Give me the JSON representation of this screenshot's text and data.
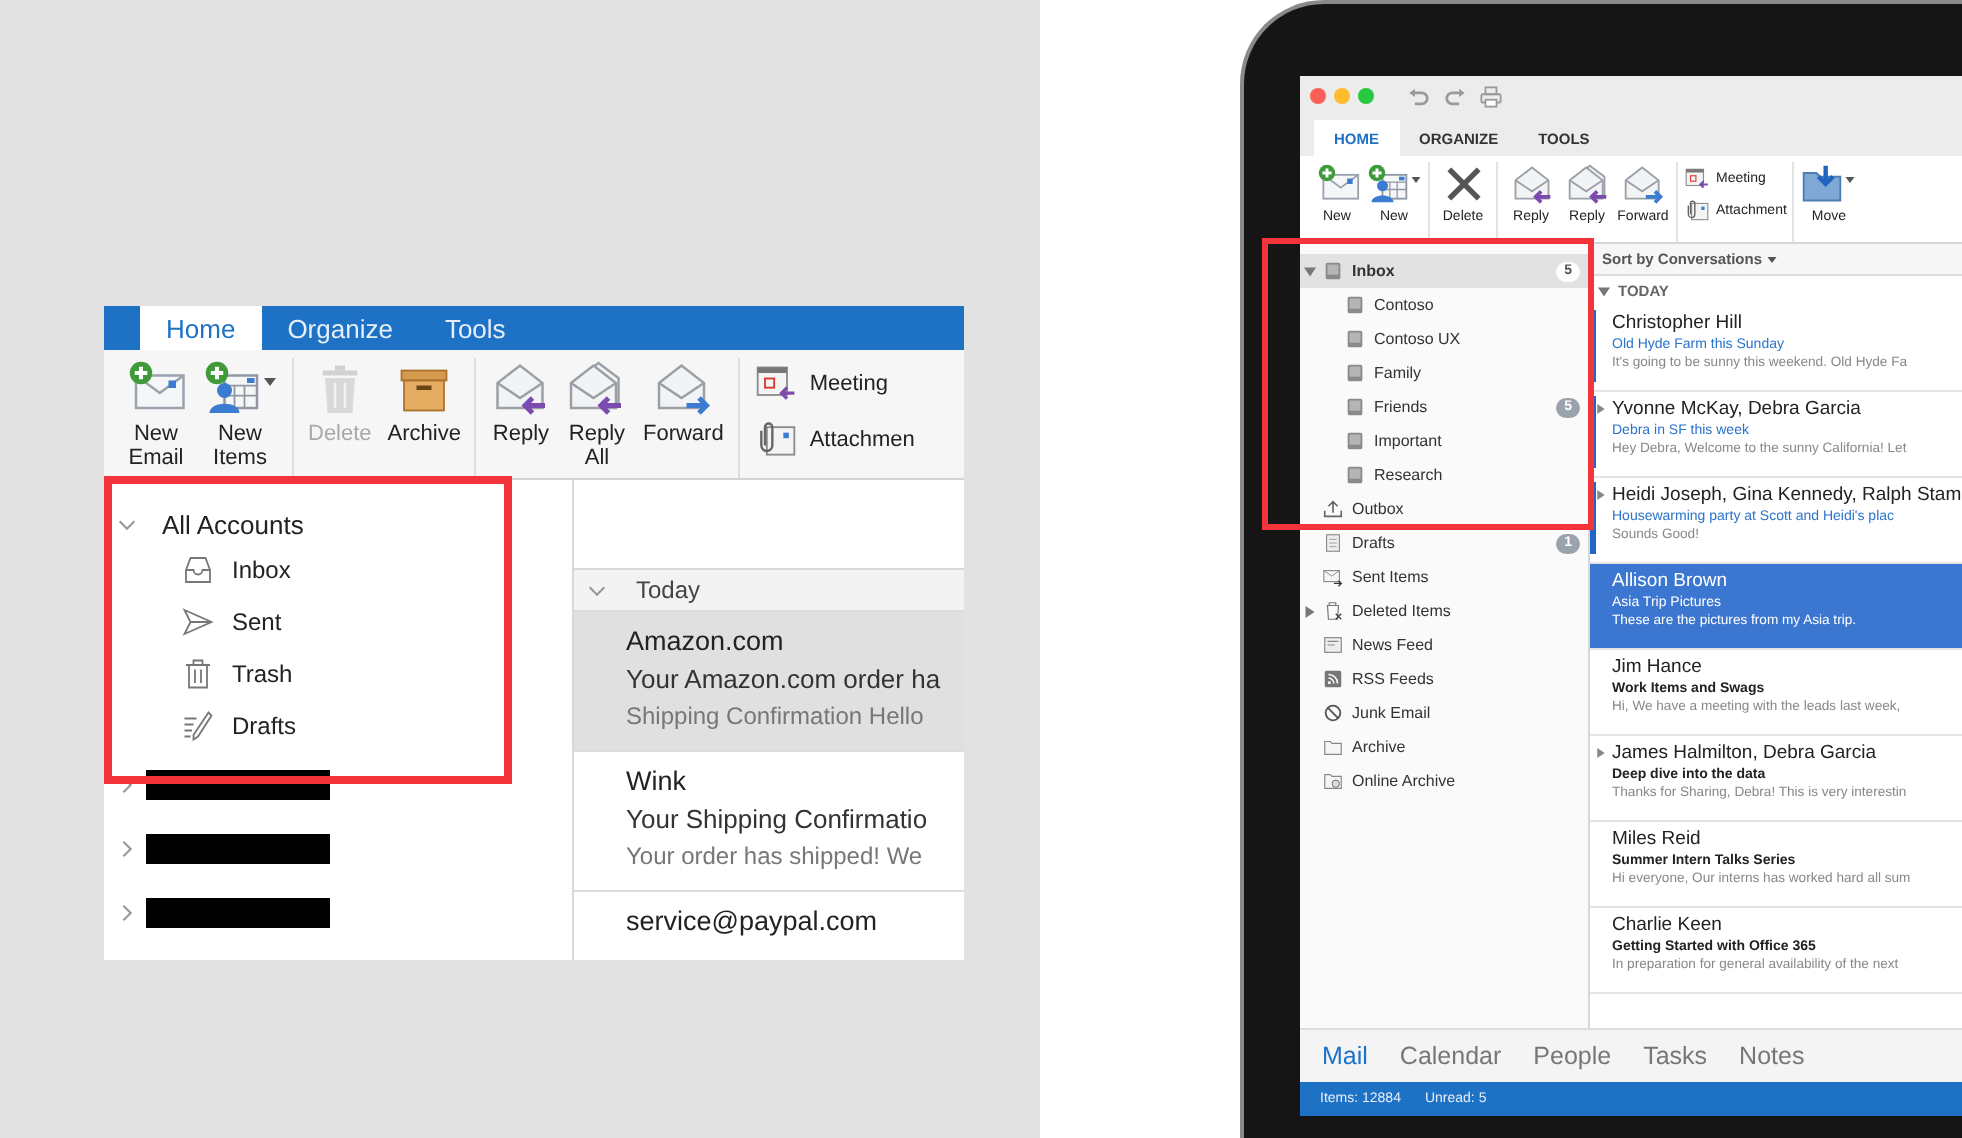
{
  "left_window": {
    "tabs": [
      {
        "label": "Home",
        "selected": true
      },
      {
        "label": "Organize",
        "selected": false
      },
      {
        "label": "Tools",
        "selected": false
      }
    ],
    "ribbon": [
      {
        "buttons": [
          {
            "kind": "new-email",
            "label": "New Email",
            "disabled": false,
            "dropdown": false
          },
          {
            "kind": "new-items",
            "label": "New Items",
            "disabled": false,
            "dropdown": true
          }
        ]
      },
      {
        "buttons": [
          {
            "kind": "delete",
            "label": "Delete",
            "disabled": true,
            "dropdown": false
          },
          {
            "kind": "archive",
            "label": "Archive",
            "disabled": false,
            "dropdown": false
          }
        ]
      },
      {
        "buttons": [
          {
            "kind": "reply",
            "label": "Reply",
            "disabled": false,
            "dropdown": false
          },
          {
            "kind": "reply-all",
            "label": "Reply All",
            "disabled": false,
            "dropdown": false
          },
          {
            "kind": "forward",
            "label": "Forward",
            "disabled": false,
            "dropdown": false
          }
        ]
      },
      {
        "buttons": [
          {
            "kind": "meeting",
            "label": "Meeting",
            "disabled": false,
            "dropdown": false
          },
          {
            "kind": "attachment",
            "label": "Attachmen",
            "disabled": false,
            "dropdown": false
          }
        ]
      }
    ],
    "folders": {
      "label": "All Accounts",
      "expanded": true,
      "children": [
        {
          "kind": "inbox",
          "label": "Inbox"
        },
        {
          "kind": "sent",
          "label": "Sent"
        },
        {
          "kind": "trash",
          "label": "Trash"
        },
        {
          "kind": "drafts",
          "label": "Drafts"
        }
      ]
    },
    "hidden_accounts": [
      {
        "expanded": false
      },
      {
        "expanded": false
      },
      {
        "expanded": false
      }
    ],
    "message_group": {
      "label": "Today",
      "expanded": true
    },
    "messages": [
      {
        "sender": "Amazon.com",
        "subject": "Your Amazon.com order ha",
        "preview": "Shipping Confirmation Hello",
        "selected": true
      },
      {
        "sender": "Wink",
        "subject": "Your Shipping Confirmatio",
        "preview": "Your order has shipped! We",
        "selected": false
      },
      {
        "sender": "service@paypal.com",
        "selected": false
      }
    ]
  },
  "right_window": {
    "tabs": [
      {
        "label": "HOME",
        "selected": true
      },
      {
        "label": "ORGANIZE",
        "selected": false
      },
      {
        "label": "TOOLS",
        "selected": false
      }
    ],
    "ribbon": [
      {
        "buttons": [
          {
            "kind": "new-email",
            "label": "New",
            "dropdown": false
          },
          {
            "kind": "new-items",
            "label": "New",
            "dropdown": true
          }
        ]
      },
      {
        "buttons": [
          {
            "kind": "delete-x",
            "label": "Delete",
            "dropdown": false
          }
        ]
      },
      {
        "buttons": [
          {
            "kind": "reply",
            "label": "Reply",
            "dropdown": false
          },
          {
            "kind": "reply-all",
            "label": "Reply",
            "dropdown": false
          },
          {
            "kind": "forward",
            "label": "Forward",
            "dropdown": false
          }
        ]
      },
      {
        "buttons": [
          {
            "kind": "meeting",
            "label": "Meeting",
            "dropdown": false
          },
          {
            "kind": "attachment",
            "label": "Attachment",
            "dropdown": false
          }
        ]
      },
      {
        "buttons": [
          {
            "kind": "move",
            "label": "Move",
            "dropdown": true
          }
        ]
      }
    ],
    "folders": [
      {
        "kind": "inbox",
        "label": "Inbox",
        "selected": true,
        "expanded": true,
        "count": "5",
        "children": [
          {
            "kind": "folder",
            "label": "Contoso",
            "selected": false
          },
          {
            "kind": "folder",
            "label": "Contoso UX",
            "selected": false
          },
          {
            "kind": "folder",
            "label": "Family",
            "selected": false
          },
          {
            "kind": "folder",
            "label": "Friends",
            "selected": false,
            "count": "5"
          },
          {
            "kind": "folder",
            "label": "Important",
            "selected": false
          },
          {
            "kind": "folder",
            "label": "Research",
            "selected": false
          }
        ]
      },
      {
        "kind": "outbox",
        "label": "Outbox",
        "selected": false
      },
      {
        "kind": "drafts",
        "label": "Drafts",
        "selected": false,
        "count": "1"
      },
      {
        "kind": "sent",
        "label": "Sent Items",
        "selected": false
      },
      {
        "kind": "deleted",
        "label": "Deleted Items",
        "selected": false,
        "expanded": false
      },
      {
        "kind": "news",
        "label": "News Feed",
        "selected": false
      },
      {
        "kind": "rss",
        "label": "RSS Feeds",
        "selected": false
      },
      {
        "kind": "junk",
        "label": "Junk Email",
        "selected": false
      },
      {
        "kind": "archive",
        "label": "Archive",
        "selected": false
      },
      {
        "kind": "online-archive",
        "label": "Online Archive",
        "selected": false
      }
    ],
    "sort": {
      "label": "Sort by Conversations"
    },
    "message_group": {
      "label": "TODAY",
      "expanded": true
    },
    "messages": [
      {
        "sender": "Christopher Hill",
        "subject": "Old Hyde Farm this Sunday",
        "preview": "It's going to be sunny this weekend. Old Hyde Fa",
        "unread": true,
        "thread": false,
        "selected": false
      },
      {
        "sender": "Yvonne McKay, Debra Garcia",
        "subject": "Debra in SF this week",
        "preview": "Hey Debra, Welcome to the sunny California! Let",
        "unread": true,
        "thread": true,
        "selected": false
      },
      {
        "sender": "Heidi Joseph, Gina Kennedy, Ralph Stam",
        "subject": "Housewarming party at Scott and Heidi's plac",
        "preview": "Sounds Good!",
        "unread": true,
        "thread": true,
        "selected": false
      },
      {
        "sender": "Allison Brown",
        "subject": "Asia Trip Pictures",
        "preview": "These are the pictures from my Asia trip.",
        "unread": false,
        "thread": false,
        "selected": true
      },
      {
        "sender": "Jim Hance",
        "subject": "Work Items and Swags",
        "preview": "Hi, We have a meeting with the leads last week,",
        "unread": false,
        "thread": false,
        "selected": false
      },
      {
        "sender": "James Halmilton, Debra Garcia",
        "subject": "Deep dive into the data",
        "preview": "Thanks for Sharing, Debra! This is very interestin",
        "unread": false,
        "thread": true,
        "selected": false
      },
      {
        "sender": "Miles Reid",
        "subject": "Summer Intern Talks Series",
        "preview": "Hi everyone, Our interns has worked hard all sum",
        "unread": false,
        "thread": false,
        "selected": false
      },
      {
        "sender": "Charlie Keen",
        "subject": "Getting Started with Office 365",
        "preview": "In preparation for general availability of the next",
        "unread": false,
        "thread": false,
        "selected": false
      }
    ],
    "nav": [
      {
        "label": "Mail",
        "selected": true
      },
      {
        "label": "Calendar",
        "selected": false
      },
      {
        "label": "People",
        "selected": false
      },
      {
        "label": "Tasks",
        "selected": false
      },
      {
        "label": "Notes",
        "selected": false
      }
    ],
    "status": [
      "Items: 12884",
      "Unread: 5"
    ]
  }
}
